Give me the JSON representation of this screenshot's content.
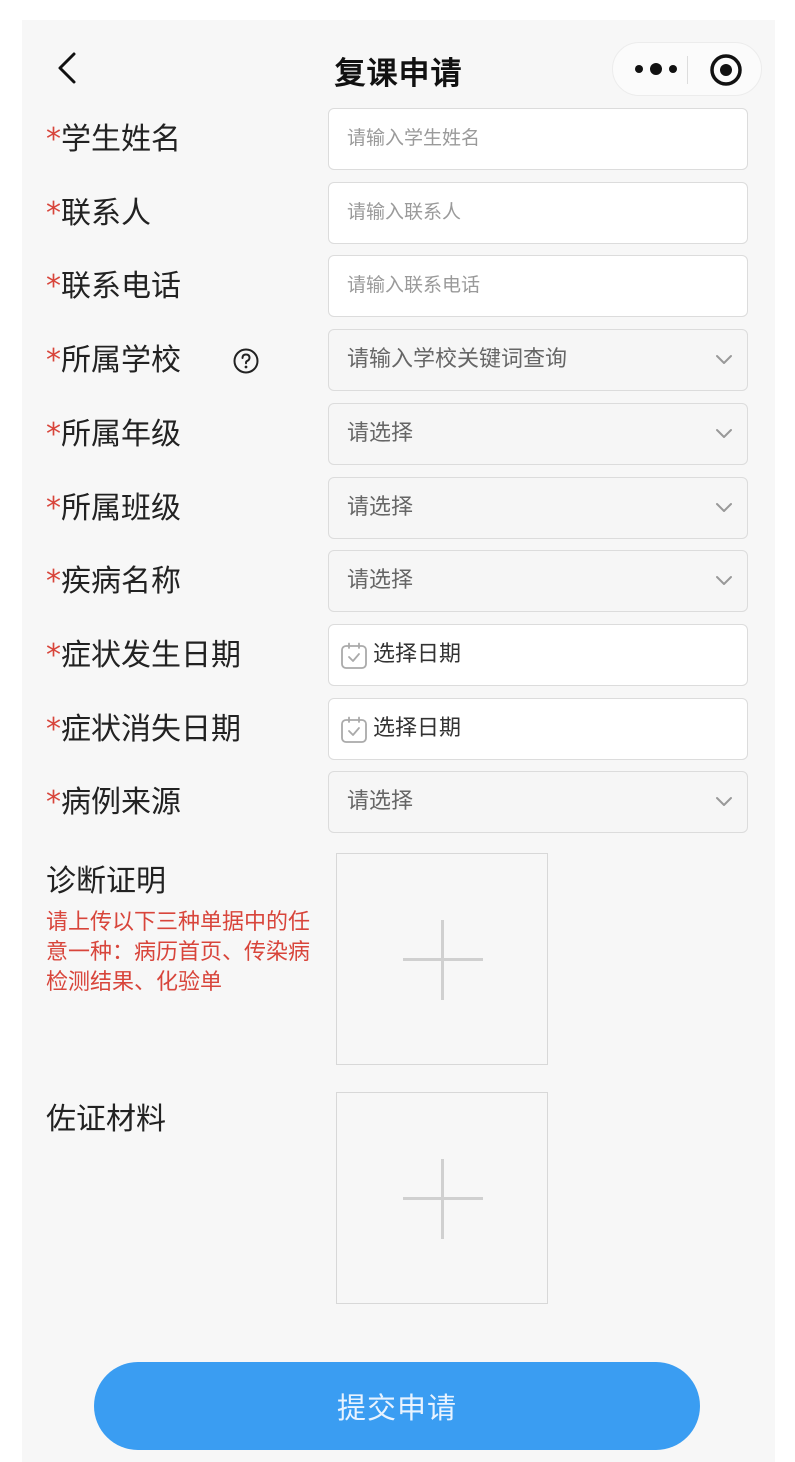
{
  "navbar": {
    "title": "复课申请",
    "back_icon": "chevron-left-icon",
    "more_icon": "more-dots-icon",
    "target_icon": "target-circle-icon"
  },
  "fields": [
    {
      "required_mark": "*",
      "label": "学生姓名",
      "type": "input",
      "value": "",
      "placeholder": "请输入学生姓名"
    },
    {
      "required_mark": "*",
      "label": "联系人",
      "type": "input",
      "value": "",
      "placeholder": "请输入联系人"
    },
    {
      "required_mark": "*",
      "label": "联系电话",
      "type": "input",
      "value": "",
      "placeholder": "请输入联系电话"
    },
    {
      "required_mark": "*",
      "label": "所属学校",
      "type": "select",
      "value": "请输入学校关键词查询",
      "help_icon": "question-circle-icon"
    },
    {
      "required_mark": "*",
      "label": "所属年级",
      "type": "select",
      "value": "请选择"
    },
    {
      "required_mark": "*",
      "label": "所属班级",
      "type": "select",
      "value": "请选择"
    },
    {
      "required_mark": "*",
      "label": "疾病名称",
      "type": "select",
      "value": "请选择"
    },
    {
      "required_mark": "*",
      "label": "症状发生日期",
      "type": "date",
      "value": "选择日期"
    },
    {
      "required_mark": "*",
      "label": "症状消失日期",
      "type": "date",
      "value": "选择日期"
    },
    {
      "required_mark": "*",
      "label": "病例来源",
      "type": "select",
      "value": "请选择"
    }
  ],
  "uploads": [
    {
      "label": "诊断证明",
      "hint": "请上传以下三种单据中的任意一种：病历首页、传染病检测结果、化验单",
      "icon": "plus-icon"
    },
    {
      "label": "佐证材料",
      "icon": "plus-icon"
    }
  ],
  "submit_label": "提交申请",
  "colors": {
    "accent": "#3a9df2",
    "required": "#d8453b",
    "background": "#f7f7f7"
  }
}
